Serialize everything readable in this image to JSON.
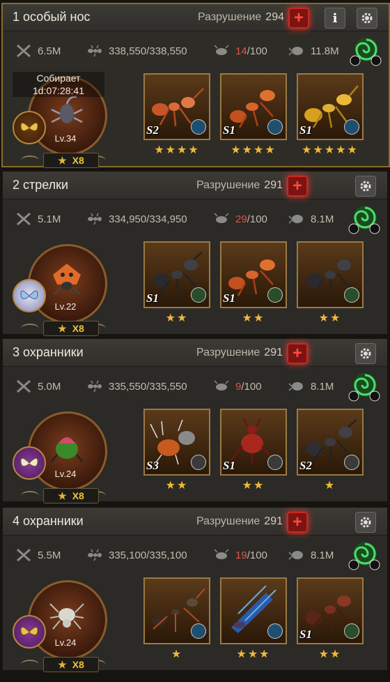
{
  "teams": [
    {
      "title": "1 особый нос",
      "destruction_label": "Разрушение",
      "destruction_value": "294",
      "power": "6.5M",
      "troops": "338,550/338,550",
      "load": "14",
      "load_max": "/100",
      "speed": "11.8M",
      "gather_label": "Собирает",
      "gather_timer": "1d:07:28:41",
      "level": "Lv.34",
      "multiplier": "X8",
      "has_info": true,
      "units": [
        {
          "grade": "S2",
          "stars": "★★★★",
          "type": "blue"
        },
        {
          "grade": "S1",
          "stars": "★★★★",
          "type": "blue"
        },
        {
          "grade": "S1",
          "stars": "★★★★★",
          "type": "blue"
        }
      ]
    },
    {
      "title": "2 стрелки",
      "destruction_label": "Разрушение",
      "destruction_value": "291",
      "power": "5.1M",
      "troops": "334,950/334,950",
      "load": "29",
      "load_max": "/100",
      "speed": "8.1M",
      "level": "Lv.22",
      "multiplier": "X8",
      "units": [
        {
          "grade": "S1",
          "stars": "★★",
          "type": "green"
        },
        {
          "grade": "S1",
          "stars": "★★",
          "type": "green"
        },
        {
          "grade": "",
          "stars": "★★",
          "type": "green"
        }
      ]
    },
    {
      "title": "3 охранники",
      "destruction_label": "Разрушение",
      "destruction_value": "291",
      "power": "5.0M",
      "troops": "335,550/335,550",
      "load": "9",
      "load_max": "/100",
      "speed": "8.1M",
      "level": "Lv.24",
      "multiplier": "X8",
      "units": [
        {
          "grade": "S3",
          "stars": "★★",
          "type": "gray"
        },
        {
          "grade": "S1",
          "stars": "★★",
          "type": "gray"
        },
        {
          "grade": "S2",
          "stars": "★",
          "type": "gray"
        }
      ]
    },
    {
      "title": "4 охранники",
      "destruction_label": "Разрушение",
      "destruction_value": "291",
      "power": "5.5M",
      "troops": "335,100/335,100",
      "load": "19",
      "load_max": "/100",
      "speed": "8.1M",
      "level": "Lv.24",
      "multiplier": "X8",
      "units": [
        {
          "grade": "",
          "stars": "★",
          "type": "blue"
        },
        {
          "grade": "",
          "stars": "★★★",
          "type": "blue"
        },
        {
          "grade": "S1",
          "stars": "★★",
          "type": "green"
        }
      ]
    }
  ],
  "colors": {
    "accent_gold": "#efb838",
    "danger_red": "#e0534b",
    "frame": "#8a6a2c"
  },
  "icons": [
    "sword-power-icon",
    "ant-troops-icon",
    "load-bug-icon",
    "speed-bug-icon",
    "swirl-skill-icon",
    "gear-icon",
    "info-icon",
    "add-red-icon"
  ]
}
